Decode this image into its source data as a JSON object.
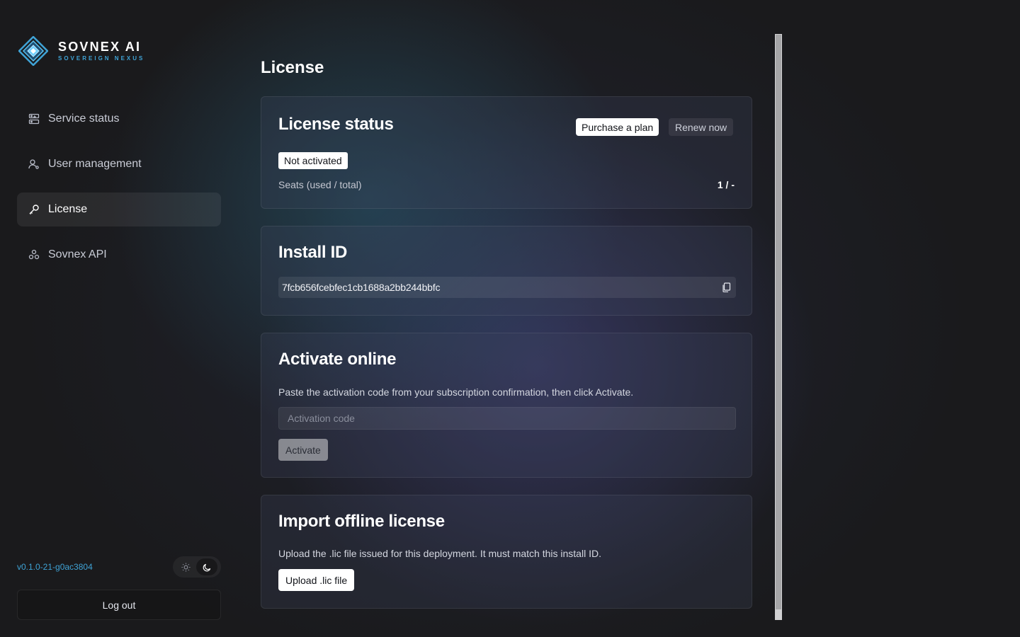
{
  "brand": {
    "title": "SOVNEX AI",
    "subtitle": "SOVEREIGN NEXUS"
  },
  "sidebar": {
    "items": [
      {
        "label": "Service status",
        "icon": "service-status-icon",
        "active": false
      },
      {
        "label": "User management",
        "icon": "user-icon",
        "active": false
      },
      {
        "label": "License",
        "icon": "key-icon",
        "active": true
      },
      {
        "label": "Sovnex API",
        "icon": "api-icon",
        "active": false
      }
    ],
    "version": "v0.1.0-21-g0ac3804",
    "logout_label": "Log out",
    "theme": "dark"
  },
  "page": {
    "title": "License"
  },
  "license_status": {
    "title": "License status",
    "purchase_label": "Purchase a plan",
    "renew_label": "Renew now",
    "badge": "Not activated",
    "seats_label": "Seats (used / total)",
    "seats_value": "1 / -"
  },
  "install": {
    "title": "Install ID",
    "id": "7fcb656fcebfec1cb1688a2bb244bbfc"
  },
  "activate": {
    "title": "Activate online",
    "description": "Paste the activation code from your subscription confirmation, then click Activate.",
    "placeholder": "Activation code",
    "button_label": "Activate"
  },
  "offline": {
    "title": "Import offline license",
    "description": "Upload the .lic file issued for this deployment. It must match this install ID.",
    "button_label": "Upload .lic file"
  },
  "colors": {
    "accent": "#3fa3d6",
    "background": "#1a1a1c"
  }
}
